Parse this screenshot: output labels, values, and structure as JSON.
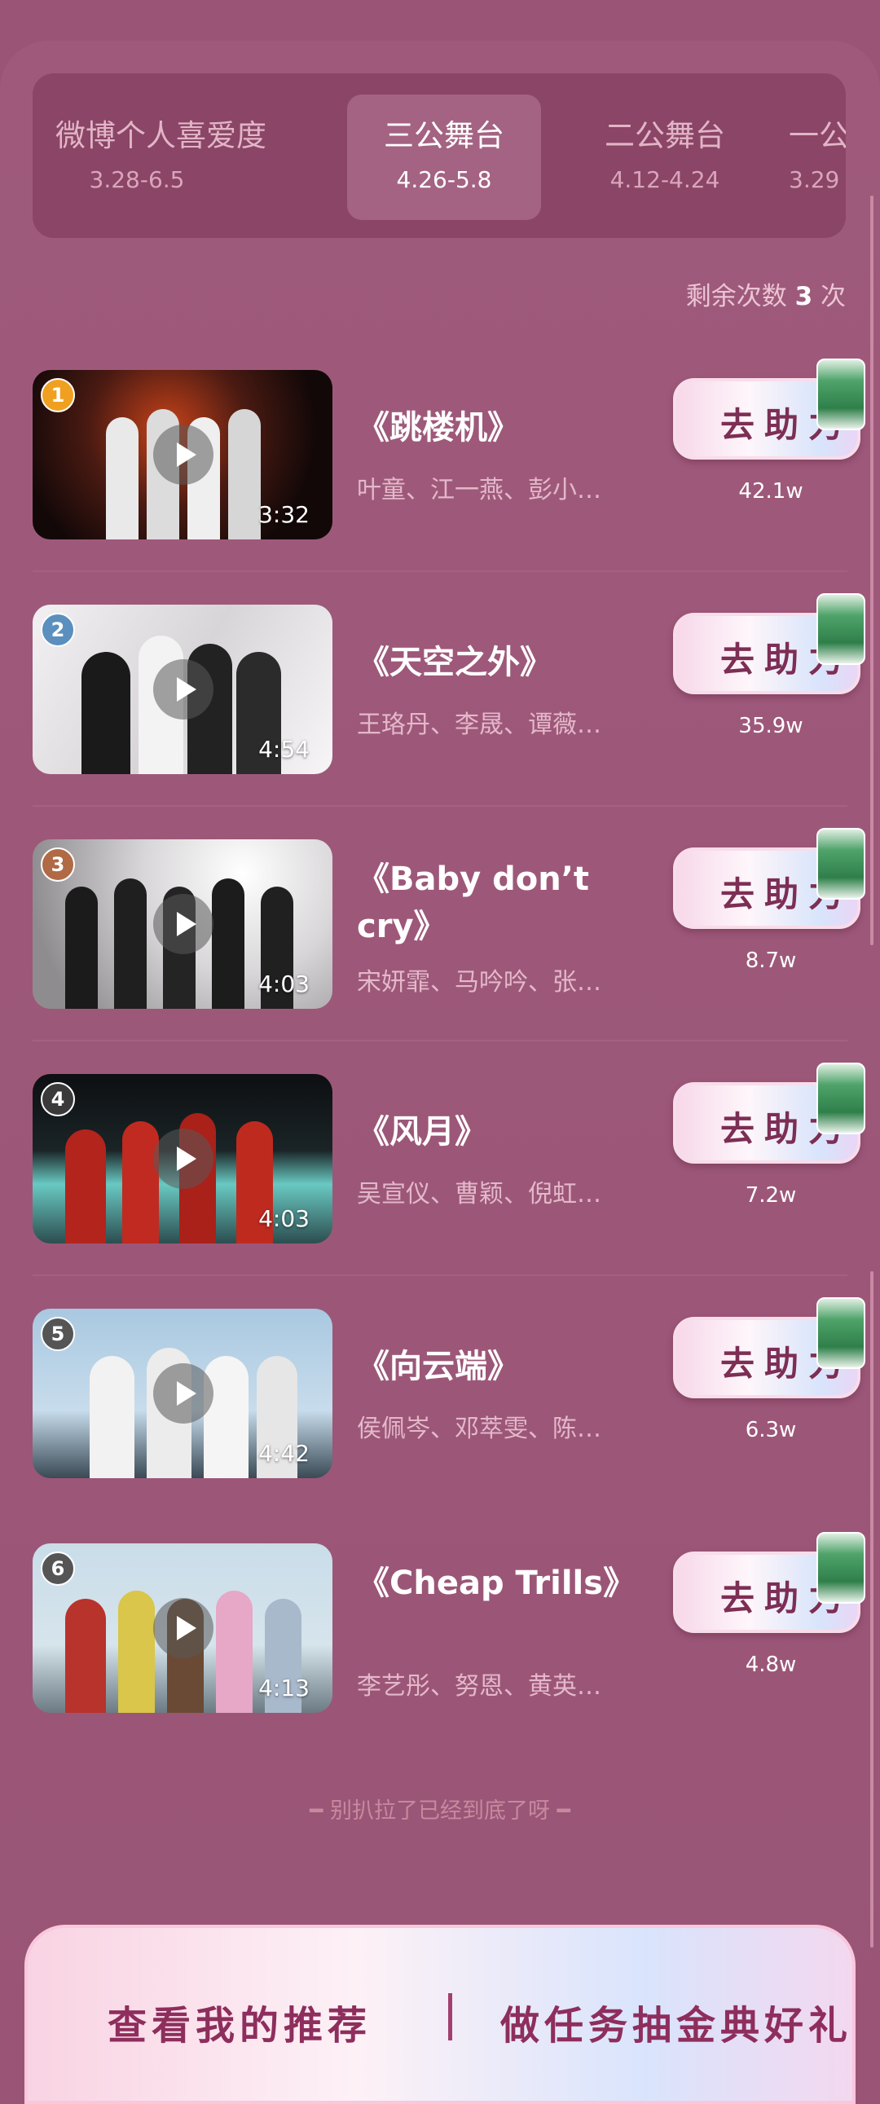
{
  "tabs": [
    {
      "name": "微博个人喜爱度",
      "dates": "3.28-6.5"
    },
    {
      "name": "三公舞台",
      "dates": "4.26-5.8"
    },
    {
      "name": "二公舞台",
      "dates": "4.12-4.24"
    },
    {
      "name": "一公",
      "dates": "3.29"
    }
  ],
  "remaining": {
    "label": "剩余次数",
    "count": "3",
    "unit": "次"
  },
  "help_label": "去助力",
  "songs": [
    {
      "rank": "1",
      "title": "《跳楼机》",
      "singers": "叶童、江一燕、彭小…",
      "duration": "3:32",
      "votes": "42.1w",
      "rank_color": "#f0a020"
    },
    {
      "rank": "2",
      "title": "《天空之外》",
      "singers": "王珞丹、李晟、谭薇…",
      "duration": "4:54",
      "votes": "35.9w",
      "rank_color": "#5b8fbd"
    },
    {
      "rank": "3",
      "title": "《Baby don’t cry》",
      "singers": "宋妍霏、马吟吟、张…",
      "duration": "4:03",
      "votes": "8.7w",
      "rank_color": "#b06a45"
    },
    {
      "rank": "4",
      "title": "《风月》",
      "singers": "吴宣仪、曹颖、倪虹…",
      "duration": "4:03",
      "votes": "7.2w",
      "rank_color": "#3a3a3a"
    },
    {
      "rank": "5",
      "title": "《向云端》",
      "singers": "侯佩岑、邓萃雯、陈…",
      "duration": "4:42",
      "votes": "6.3w",
      "rank_color": "#555555"
    },
    {
      "rank": "6",
      "title": "《Cheap Trills》",
      "singers": "李艺彤、努恩、黄英…",
      "duration": "4:13",
      "votes": "4.8w",
      "rank_color": "#555555"
    }
  ],
  "end_note": "━ 别扒拉了已经到底了呀 ━",
  "bottom": {
    "left": "查看我的推荐",
    "right": "做任务抽金典好礼"
  }
}
